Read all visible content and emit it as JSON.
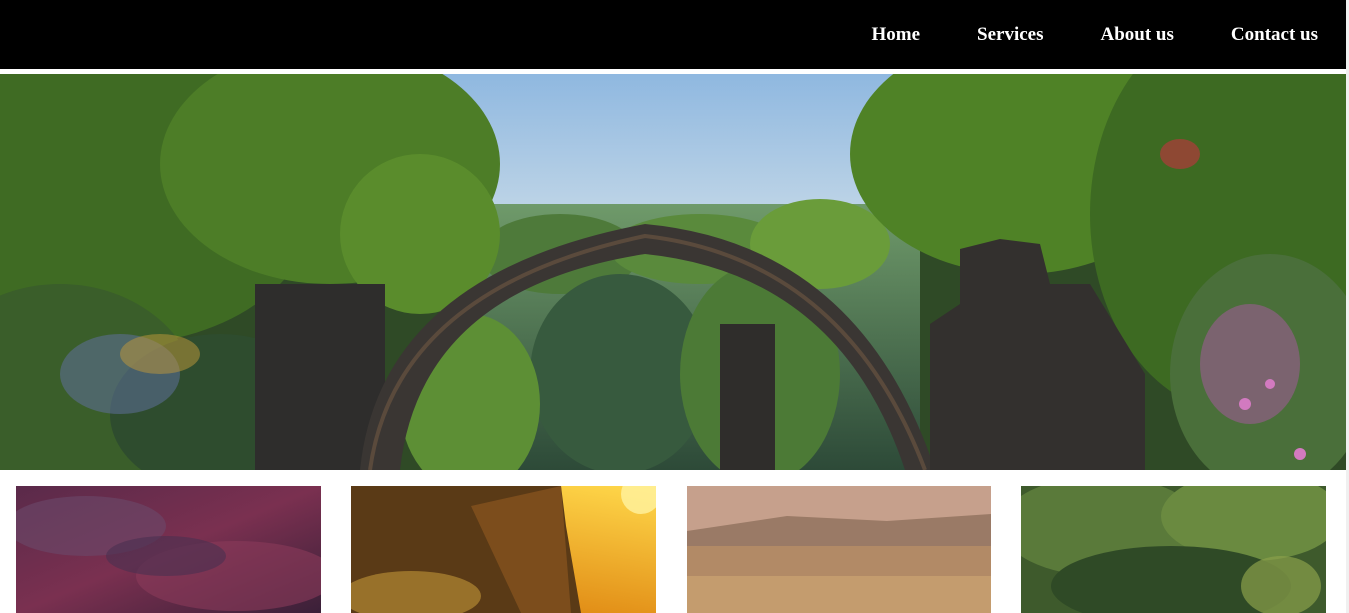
{
  "nav": {
    "items": [
      {
        "label": "Home"
      },
      {
        "label": "Services"
      },
      {
        "label": "About us"
      },
      {
        "label": "Contact us"
      }
    ]
  },
  "hero": {
    "image": "stone-arch-bridge-in-forest-photo"
  },
  "gallery": {
    "cards": [
      {
        "image": "purple-forest-photo"
      },
      {
        "image": "sunset-cliff-photo"
      },
      {
        "image": "foggy-field-photo"
      },
      {
        "image": "green-trees-photo"
      }
    ]
  },
  "colors": {
    "navbar_bg": "#000000",
    "nav_text": "#ffffff",
    "page_bg": "#ffffff"
  }
}
